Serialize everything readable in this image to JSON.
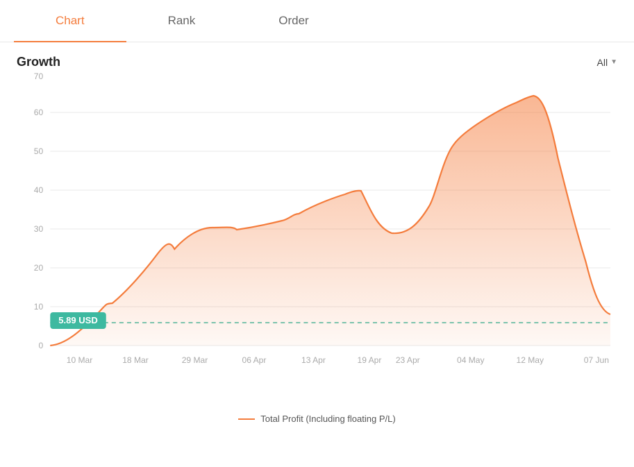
{
  "tabs": [
    {
      "id": "chart",
      "label": "Chart",
      "active": true
    },
    {
      "id": "rank",
      "label": "Rank",
      "active": false
    },
    {
      "id": "order",
      "label": "Order",
      "active": false
    }
  ],
  "growth": {
    "title": "Growth",
    "filter": "All"
  },
  "chart": {
    "yAxis": [
      "70",
      "60",
      "50",
      "40",
      "30",
      "20",
      "10",
      "0"
    ],
    "xAxis": [
      "10 Mar",
      "18 Mar",
      "29 Mar",
      "06 Apr",
      "13 Apr",
      "19 Apr",
      "23 Apr",
      "04 May",
      "12 May",
      "07 Jun"
    ],
    "baselineLabel": "5.89 USD",
    "baselineValue": 5.89,
    "legend": "Total Profit (Including floating P/L)"
  },
  "accent": "#f47c3c",
  "teal": "#3db9a0"
}
